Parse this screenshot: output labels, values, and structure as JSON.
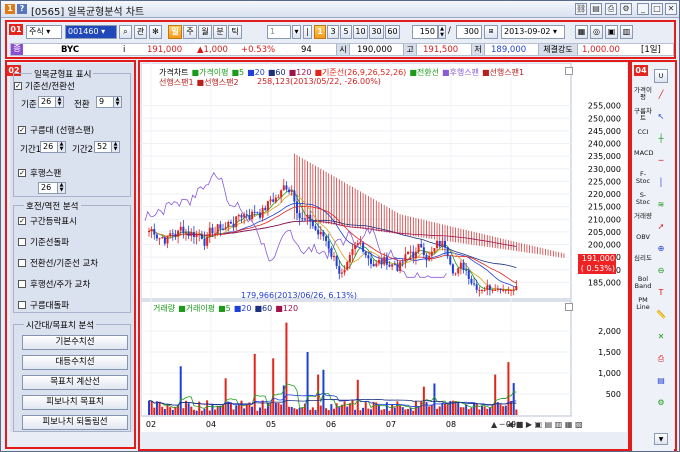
{
  "window": {
    "code_title": "[0565] 일목균형분석 차트",
    "title_badges": [
      "1",
      "?"
    ]
  },
  "toolbar": {
    "market_select": "주식",
    "stock_code": "001460",
    "btn_gwan": "관",
    "btn_ilmok": "일",
    "periods": [
      "주",
      "월",
      "분",
      "틱"
    ],
    "num_buttons": [
      "1",
      "3",
      "5",
      "10",
      "30",
      "60"
    ],
    "count_value": "150",
    "total_value": "300",
    "date_value": "2013-09-02"
  },
  "price_row": {
    "badge": "종",
    "stock_name": "BYC",
    "price": "191,000",
    "change": "▲1,000",
    "change_pct": "+0.53%",
    "volume": "94",
    "open_label": "시",
    "open": "190,000",
    "high_label": "고",
    "high": "191,500",
    "low_label": "저",
    "low": "189,000",
    "strength_label": "체결강도",
    "strength": "1,000.00",
    "period_label": "[1일]"
  },
  "left_panel": {
    "badge": "02",
    "group1_title": "일목균형표 표시",
    "base_line_label": "기준선/전환선",
    "base_label": "기준",
    "base_value": "26",
    "conv_label": "전환",
    "conv_value": "9",
    "cloud_label": "구름대 (선행스팬)",
    "span1_label": "기간1",
    "span1_value": "26",
    "span2_label": "기간2",
    "span2_value": "52",
    "lag_label": "후행스팬",
    "lag_value": "26",
    "group2_title": "호전/역전 분석",
    "options": [
      "구간등락표시",
      "기준선돌파",
      "전환선/기준선 교차",
      "후행선/주가 교차",
      "구름대돌파"
    ],
    "options_checked": [
      true,
      false,
      false,
      false,
      false
    ],
    "group3_title": "시간대/목표치 분석",
    "buttons": [
      "기본수치선",
      "대등수치선",
      "목표치 계산선",
      "피보나치 목표치",
      "피보나치 되돌림선"
    ]
  },
  "chart": {
    "badge": "03",
    "legend_line1": [
      {
        "text": "가격차트",
        "color": "#000000"
      },
      {
        "text": "가격이평",
        "color": "#1a9c1a"
      },
      {
        "text": "5",
        "color": "#1a9c1a"
      },
      {
        "text": "20",
        "color": "#1f3fd6"
      },
      {
        "text": "60",
        "color": "#1b2f80"
      },
      {
        "text": "120",
        "color": "#a0124d"
      },
      {
        "text": "기준선(26,9,26,52,26)",
        "color": "#e2231a"
      },
      {
        "text": "전환선",
        "color": "#1a9c1a"
      },
      {
        "text": "후행스팬",
        "color": "#8a5cd6"
      },
      {
        "text": "선행스팬1",
        "color": "#b81f1f"
      }
    ],
    "legend_line2": [
      {
        "text": "선행스팬1",
        "color": "#b81f1f"
      },
      {
        "text": "선행스팬2",
        "color": "#b81f1f"
      }
    ],
    "annotation_high": "258,123(2013/05/22, -26.00%)",
    "annotation_low": "179,966(2013/06/26, 6.13%)",
    "price_ticks": [
      "255,000",
      "250,000",
      "245,000",
      "240,000",
      "235,000",
      "230,000",
      "225,000",
      "220,000",
      "215,000",
      "210,000",
      "205,000",
      "200,000",
      "195,000",
      "190,000",
      "185,000"
    ],
    "current_price_tag": "191,000",
    "current_pct_tag": "( 0.53%)",
    "volume_legend": [
      {
        "text": "거래량",
        "color": "#1a9c1a"
      },
      {
        "text": "거래이평",
        "color": "#1a9c1a"
      },
      {
        "text": "5",
        "color": "#1a9c1a"
      },
      {
        "text": "20",
        "color": "#1f3fd6"
      },
      {
        "text": "60",
        "color": "#1b2f80"
      },
      {
        "text": "120",
        "color": "#a0124d"
      }
    ],
    "volume_ticks": [
      "2,000",
      "1,500",
      "1,000",
      "500"
    ],
    "x_ticks": [
      "02",
      "04",
      "05",
      "06",
      "07",
      "08",
      "09"
    ]
  },
  "right_tools": {
    "badge": "04",
    "labels": [
      "가격이평",
      "구름차트",
      "CCI",
      "MACD",
      "F-Stoc",
      "S-Stoc",
      "거래량",
      "OBV",
      "심리도",
      "Bol Band",
      "PM Line"
    ],
    "icons": [
      "trend-line-icon",
      "cursor-icon",
      "cross-line-icon",
      "horizontal-line-icon",
      "vertical-line-icon",
      "fibonacci-icon",
      "arrow-icon",
      "zoom-in-icon",
      "zoom-out-icon",
      "text-icon",
      "ruler-icon",
      "delete-icon",
      "print-icon",
      "save-icon",
      "setting-icon"
    ]
  }
}
